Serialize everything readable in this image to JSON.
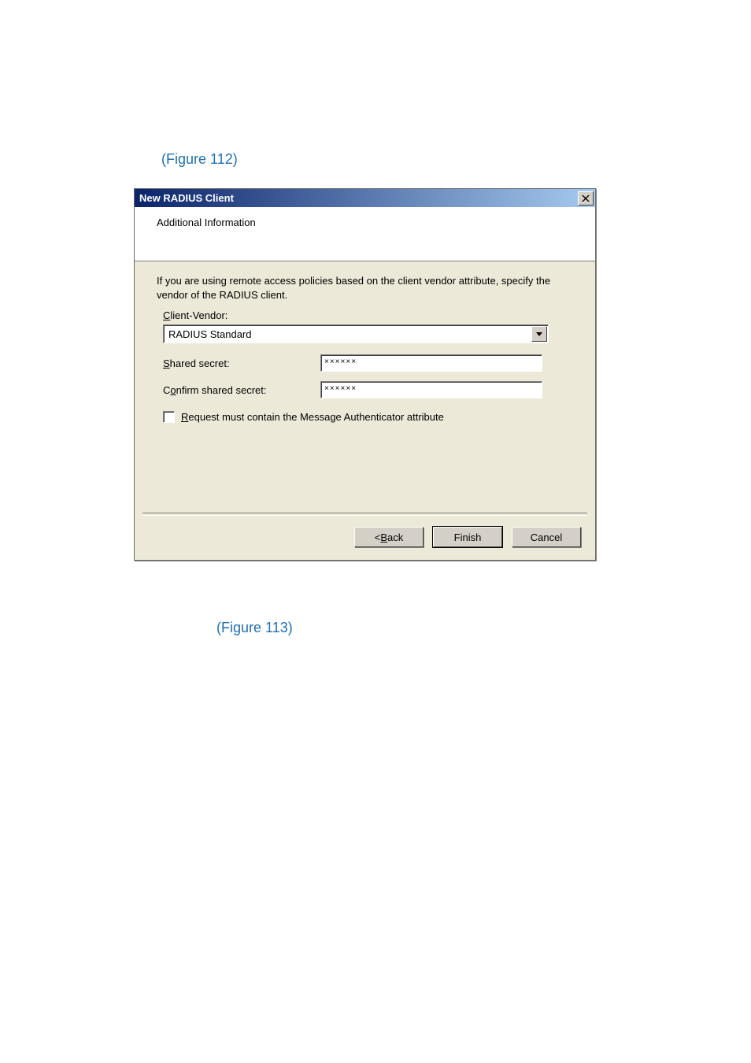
{
  "links": {
    "fig1": {
      "black_prefix": "",
      "paren_open": "(",
      "link": "Figure 112",
      "paren_close": ")"
    },
    "fig2": {
      "black_prefix": "",
      "paren_open": "(",
      "link": "Figure 113",
      "paren_close": ")"
    }
  },
  "dialog": {
    "title": "New RADIUS Client",
    "banner": "Additional Information",
    "instruction": "If you are using remote access policies based on the client vendor attribute, specify the vendor of the RADIUS client.",
    "client_vendor": {
      "label_pre": "",
      "label_ul": "C",
      "label_post": "lient-Vendor:",
      "value": "RADIUS Standard"
    },
    "shared_secret": {
      "label_ul": "S",
      "label_post": "hared secret:",
      "value": "××××××"
    },
    "confirm_secret": {
      "label_pre": "C",
      "label_ul": "o",
      "label_post": "nfirm shared secret:",
      "value": "××××××"
    },
    "checkbox": {
      "label_ul": "R",
      "label_post": "equest must contain the Message Authenticator attribute"
    },
    "buttons": {
      "back_pre": "< ",
      "back_ul": "B",
      "back_post": "ack",
      "finish": "Finish",
      "cancel": "Cancel"
    }
  }
}
